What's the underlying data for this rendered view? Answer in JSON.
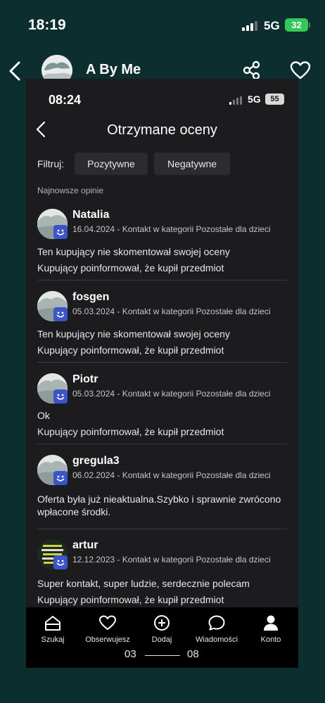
{
  "outer": {
    "status": {
      "time": "18:19",
      "network": "5G",
      "battery": "32"
    },
    "header": {
      "title": "A  By Me"
    }
  },
  "inner": {
    "status": {
      "time": "08:24",
      "network": "5G",
      "battery": "55"
    },
    "title": "Otrzymane oceny",
    "filter": {
      "label": "Filtruj:",
      "options": [
        "Pozytywne",
        "Negatywne"
      ]
    },
    "section_label": "Najnowsze opinie",
    "reviews": [
      {
        "name": "Natalia",
        "meta": "16.04.2024 - Kontakt w kategorii Pozostałe dla dzieci",
        "lines": [
          "Ten kupujący nie skomentował swojej oceny",
          "Kupujący poinformował, że kupił przedmiot"
        ]
      },
      {
        "name": "fosgen",
        "meta": "05.03.2024 - Kontakt w kategorii Pozostałe dla dzieci",
        "lines": [
          "Ten kupujący nie skomentował swojej oceny",
          "Kupujący poinformował, że kupił przedmiot"
        ]
      },
      {
        "name": "Piotr",
        "meta": "05.03.2024 - Kontakt w kategorii Pozostałe dla dzieci",
        "lines": [
          "Ok",
          "Kupujący poinformował, że kupił przedmiot"
        ]
      },
      {
        "name": "gregula3",
        "meta": "06.02.2024 - Kontakt w kategorii Pozostałe dla dzieci",
        "lines": [
          "Oferta była już nieaktualna.Szybko i sprawnie zwrócono wpłacone środki."
        ]
      },
      {
        "name": "artur",
        "meta": "12.12.2023 - Kontakt w kategorii Pozostałe dla dzieci",
        "lines": [
          "Super kontakt, super ludzie, serdecznie polecam",
          "Kupujący poinformował, że kupił przedmiot"
        ]
      }
    ],
    "nav": [
      {
        "label": "Szukaj",
        "icon": "home-icon"
      },
      {
        "label": "Obserwujesz",
        "icon": "heart-icon"
      },
      {
        "label": "Dodaj",
        "icon": "plus-circle-icon"
      },
      {
        "label": "Wiadomości",
        "icon": "chat-bubble-icon"
      },
      {
        "label": "Konto",
        "icon": "person-icon"
      }
    ],
    "pager": {
      "current": "03",
      "total": "08"
    }
  },
  "colors": {
    "outer_background": "#0d2e2e",
    "inner_background": "#1c1c1e",
    "badge_blue": "#3b55c8",
    "battery_green": "#34c759"
  }
}
